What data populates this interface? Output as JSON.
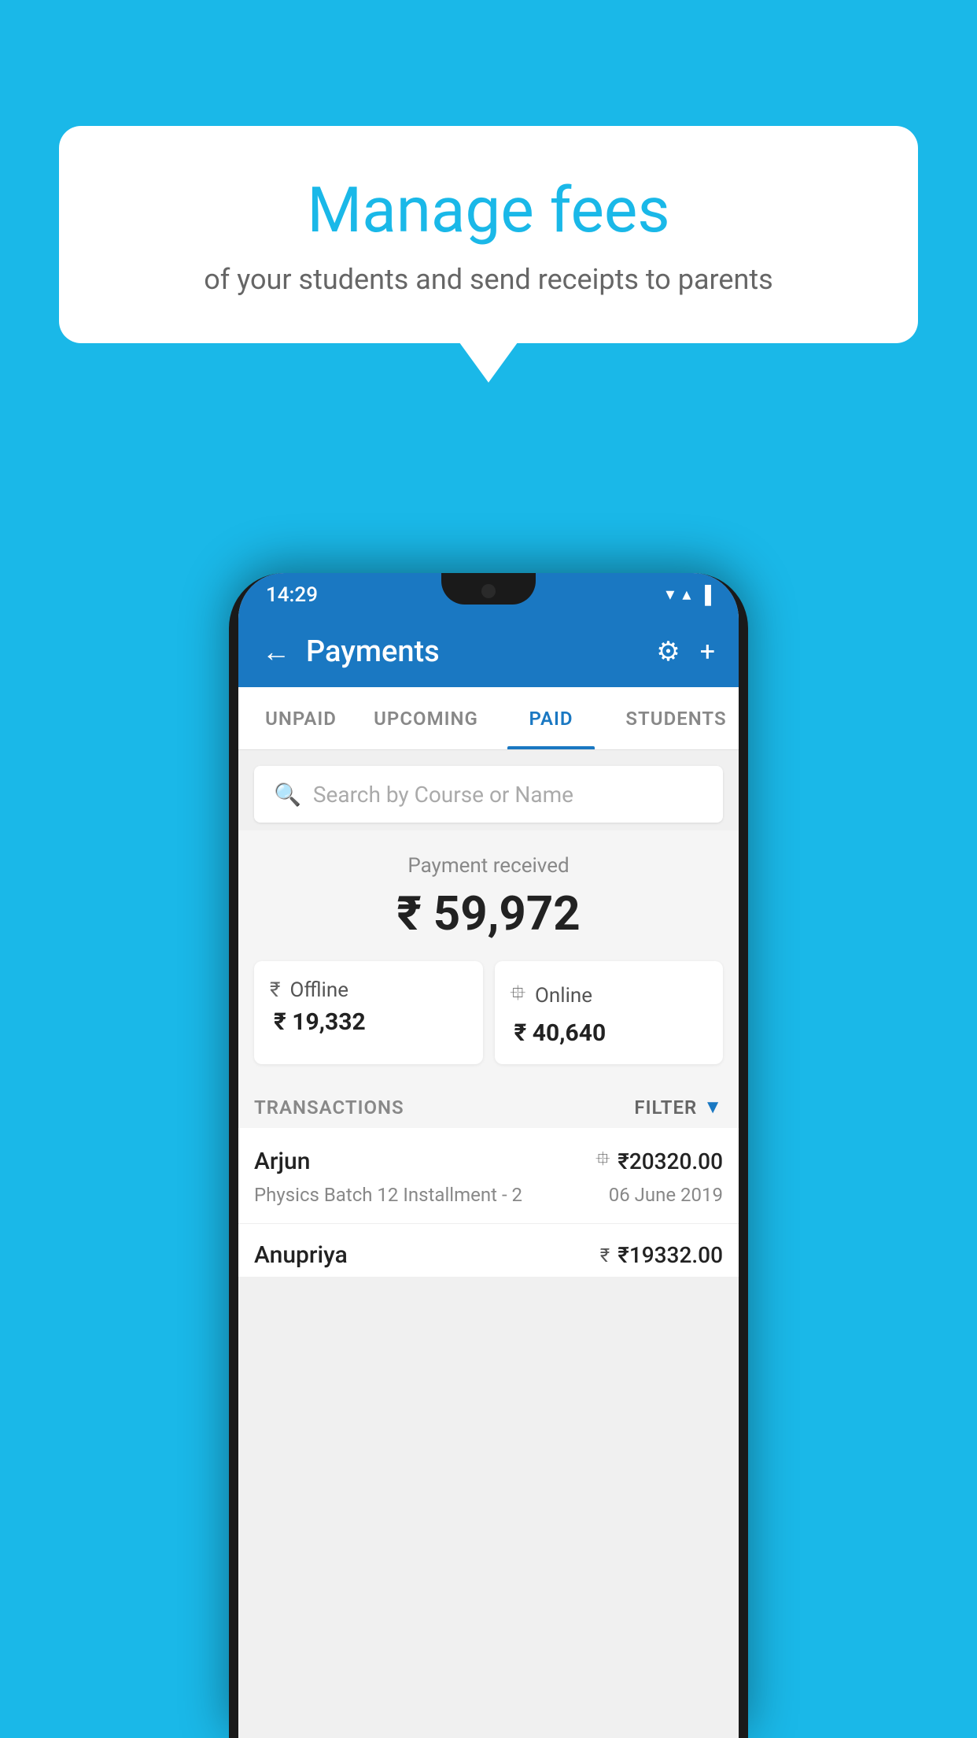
{
  "background_color": "#1ab8e8",
  "speech_bubble": {
    "title": "Manage fees",
    "subtitle": "of your students and send receipts to parents"
  },
  "phone": {
    "status_bar": {
      "time": "14:29",
      "wifi": "▼",
      "signal": "▲",
      "battery": "▐"
    },
    "header": {
      "back_label": "←",
      "title": "Payments",
      "gear_label": "⚙",
      "plus_label": "+"
    },
    "tabs": [
      {
        "id": "unpaid",
        "label": "UNPAID",
        "active": false
      },
      {
        "id": "upcoming",
        "label": "UPCOMING",
        "active": false
      },
      {
        "id": "paid",
        "label": "PAID",
        "active": true
      },
      {
        "id": "students",
        "label": "STUDENTS",
        "active": false
      }
    ],
    "search": {
      "placeholder": "Search by Course or Name"
    },
    "payment_received": {
      "label": "Payment received",
      "amount": "₹ 59,972",
      "offline": {
        "label": "Offline",
        "amount": "₹ 19,332"
      },
      "online": {
        "label": "Online",
        "amount": "₹ 40,640"
      }
    },
    "transactions_header": {
      "label": "TRANSACTIONS",
      "filter_label": "FILTER"
    },
    "transactions": [
      {
        "name": "Arjun",
        "amount": "₹20320.00",
        "course": "Physics Batch 12 Installment - 2",
        "date": "06 June 2019",
        "type_icon": "card"
      },
      {
        "name": "Anupriya",
        "amount": "₹19332.00",
        "course": "",
        "date": "",
        "type_icon": "cash"
      }
    ]
  }
}
